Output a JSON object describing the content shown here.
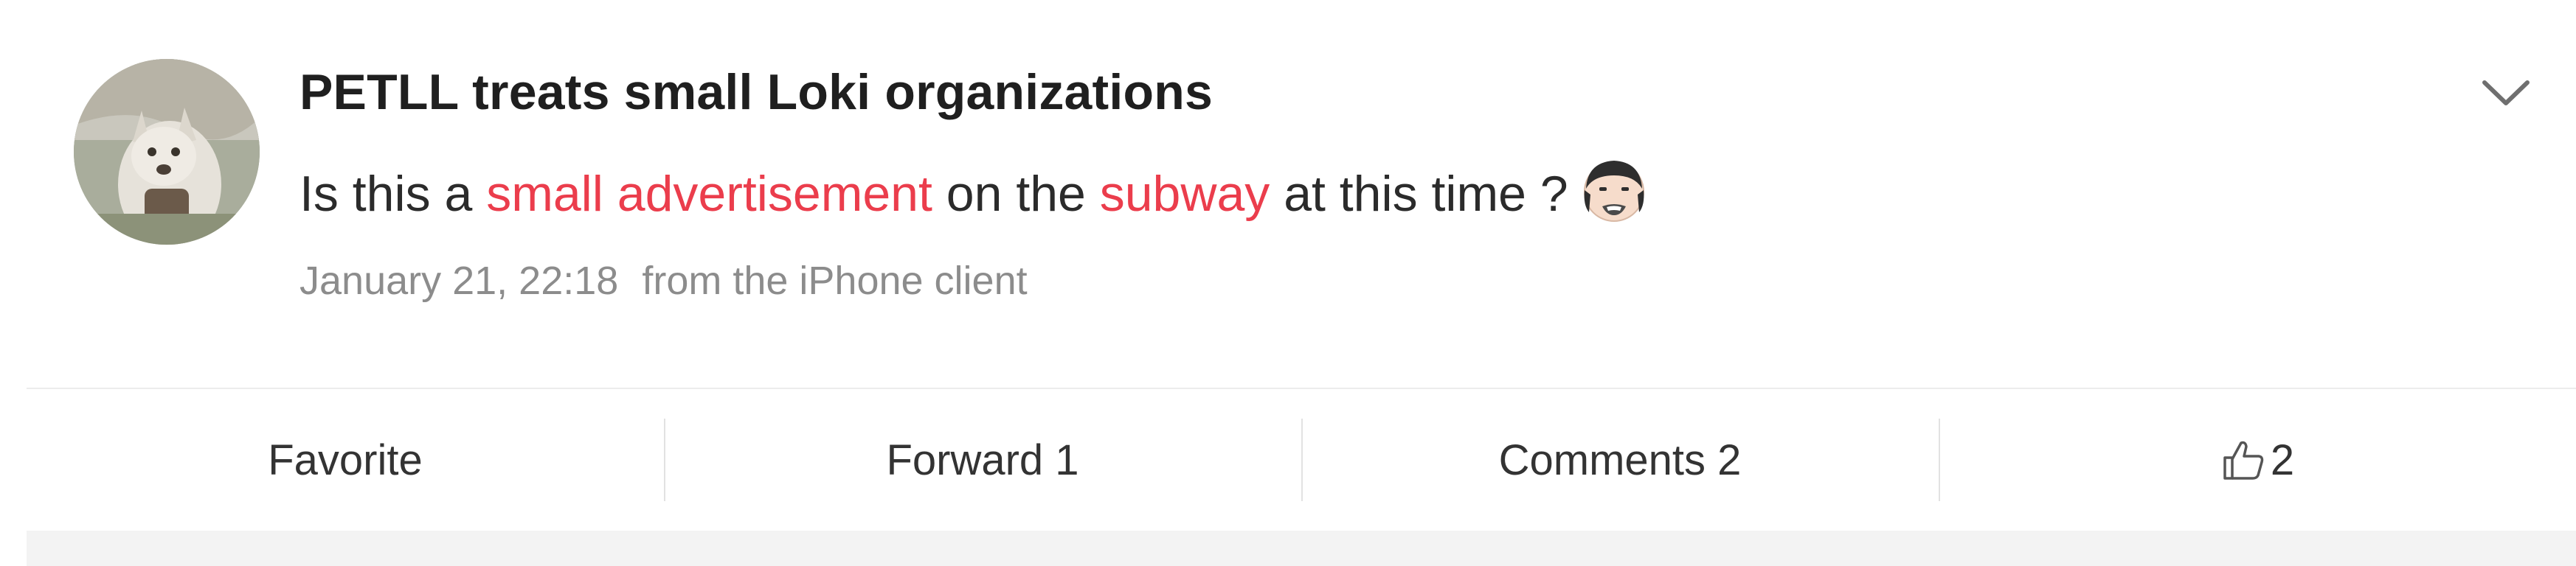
{
  "post": {
    "author": "PETLL treats small Loki organizations",
    "text_parts": {
      "p1": "Is this a ",
      "link1": "small advertisement",
      "p2": " on the ",
      "link2": "subway",
      "p3": " at this time ?"
    },
    "emoji_icon": "face-emoji-icon",
    "timestamp": "January 21, 22:18",
    "source": "from the iPhone client",
    "menu_icon": "chevron-down-icon",
    "highlight_color": "#eb3d4c"
  },
  "actions": {
    "favorite": "Favorite",
    "forward": "Forward 1",
    "comments": "Comments 2",
    "like_icon": "thumbs-up-icon",
    "like_count": "2"
  }
}
